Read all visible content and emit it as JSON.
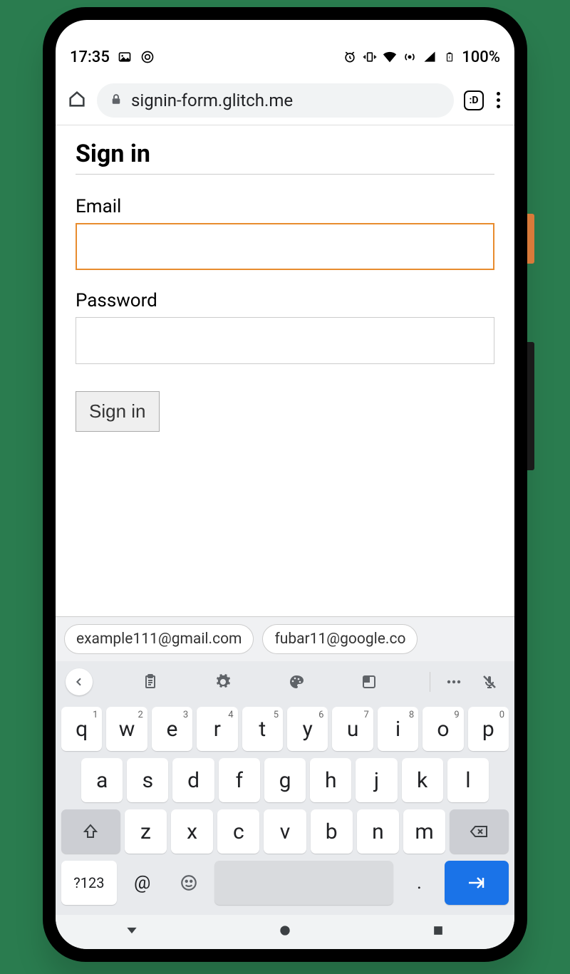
{
  "status_bar": {
    "time": "17:35",
    "battery_text": "100%"
  },
  "browser": {
    "url_display": "signin-form.glitch.me",
    "tab_badge": ":D"
  },
  "page": {
    "title": "Sign in",
    "email_label": "Email",
    "password_label": "Password",
    "signin_button": "Sign in"
  },
  "keyboard": {
    "suggestions": [
      "example111@gmail.com",
      "fubar11@google.co"
    ],
    "row1": [
      {
        "k": "q",
        "n": "1"
      },
      {
        "k": "w",
        "n": "2"
      },
      {
        "k": "e",
        "n": "3"
      },
      {
        "k": "r",
        "n": "4"
      },
      {
        "k": "t",
        "n": "5"
      },
      {
        "k": "y",
        "n": "6"
      },
      {
        "k": "u",
        "n": "7"
      },
      {
        "k": "i",
        "n": "8"
      },
      {
        "k": "o",
        "n": "9"
      },
      {
        "k": "p",
        "n": "0"
      }
    ],
    "row2": [
      "a",
      "s",
      "d",
      "f",
      "g",
      "h",
      "j",
      "k",
      "l"
    ],
    "row3": [
      "z",
      "x",
      "c",
      "v",
      "b",
      "n",
      "m"
    ],
    "symkey": "?123",
    "at_key": "@",
    "dot_key": "."
  }
}
